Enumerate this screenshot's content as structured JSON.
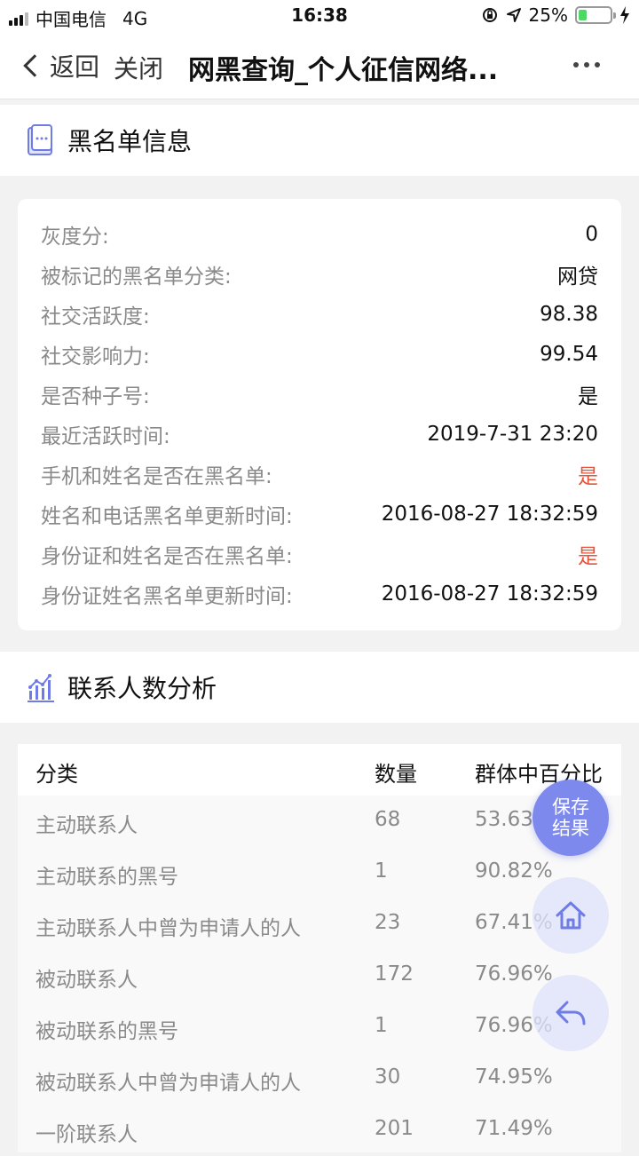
{
  "status_bar": {
    "carrier": "中国电信",
    "network": "4G",
    "time": "16:38",
    "battery": "25%",
    "battery_level": 0.25
  },
  "nav": {
    "back_label": "返回",
    "close_label": "关闭",
    "title": "网黑查询_个人征信网络..."
  },
  "blacklist_section": {
    "title": "黑名单信息",
    "rows": [
      {
        "key": "灰度分:",
        "value": "0"
      },
      {
        "key": "被标记的黑名单分类:",
        "value": "网贷"
      },
      {
        "key": "社交活跃度:",
        "value": "98.38"
      },
      {
        "key": "社交影响力:",
        "value": "99.54"
      },
      {
        "key": "是否种子号:",
        "value": "是"
      },
      {
        "key": "最近活跃时间:",
        "value": "2019-7-31 23:20"
      },
      {
        "key": "手机和姓名是否在黑名单:",
        "value": "是"
      },
      {
        "key": "姓名和电话黑名单更新时间:",
        "value": "2016-08-27 18:32:59"
      },
      {
        "key": "身份证和姓名是否在黑名单:",
        "value": "是"
      },
      {
        "key": "身份证姓名黑名单更新时间:",
        "value": "2016-08-27 18:32:59"
      }
    ]
  },
  "contacts_section": {
    "title": "联系人数分析",
    "headers": [
      "分类",
      "数量",
      "群体中百分比"
    ],
    "rows": [
      [
        "主动联系人",
        "68",
        "53.63%"
      ],
      [
        "主动联系的黑号",
        "1",
        "90.82%"
      ],
      [
        "主动联系人中曾为申请人的人",
        "23",
        "67.41%"
      ],
      [
        "被动联系人",
        "172",
        "76.96%"
      ],
      [
        "被动联系的黑号",
        "1",
        "76.96%"
      ],
      [
        "被动联系人中曾为申请人的人",
        "30",
        "74.95%"
      ],
      [
        "一阶联系人",
        "201",
        "71.49%"
      ]
    ]
  },
  "fab": {
    "save_line1": "保存",
    "save_line2": "结果"
  },
  "colors": {
    "accent": "#7e89ee",
    "alert_red": "#e5533a",
    "battery_green": "#4cd964"
  }
}
